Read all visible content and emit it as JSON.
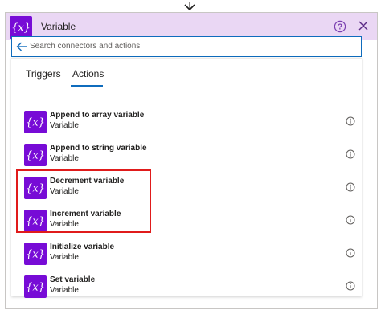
{
  "header": {
    "title": "Variable",
    "icon": "variable-icon",
    "help_icon": "help-icon",
    "close_icon": "close-icon"
  },
  "search": {
    "placeholder": "Search connectors and actions",
    "value": ""
  },
  "tabs": [
    {
      "label": "Triggers",
      "selected": false
    },
    {
      "label": "Actions",
      "selected": true
    }
  ],
  "actions": [
    {
      "name": "Append to array variable",
      "connector": "Variable"
    },
    {
      "name": "Append to string variable",
      "connector": "Variable"
    },
    {
      "name": "Decrement variable",
      "connector": "Variable"
    },
    {
      "name": "Increment variable",
      "connector": "Variable"
    },
    {
      "name": "Initialize variable",
      "connector": "Variable"
    },
    {
      "name": "Set variable",
      "connector": "Variable"
    }
  ],
  "colors": {
    "brand": "#770bd6",
    "header_bg": "#ead7f4",
    "accent": "#0f6cbd",
    "highlight": "#e01b1b"
  }
}
